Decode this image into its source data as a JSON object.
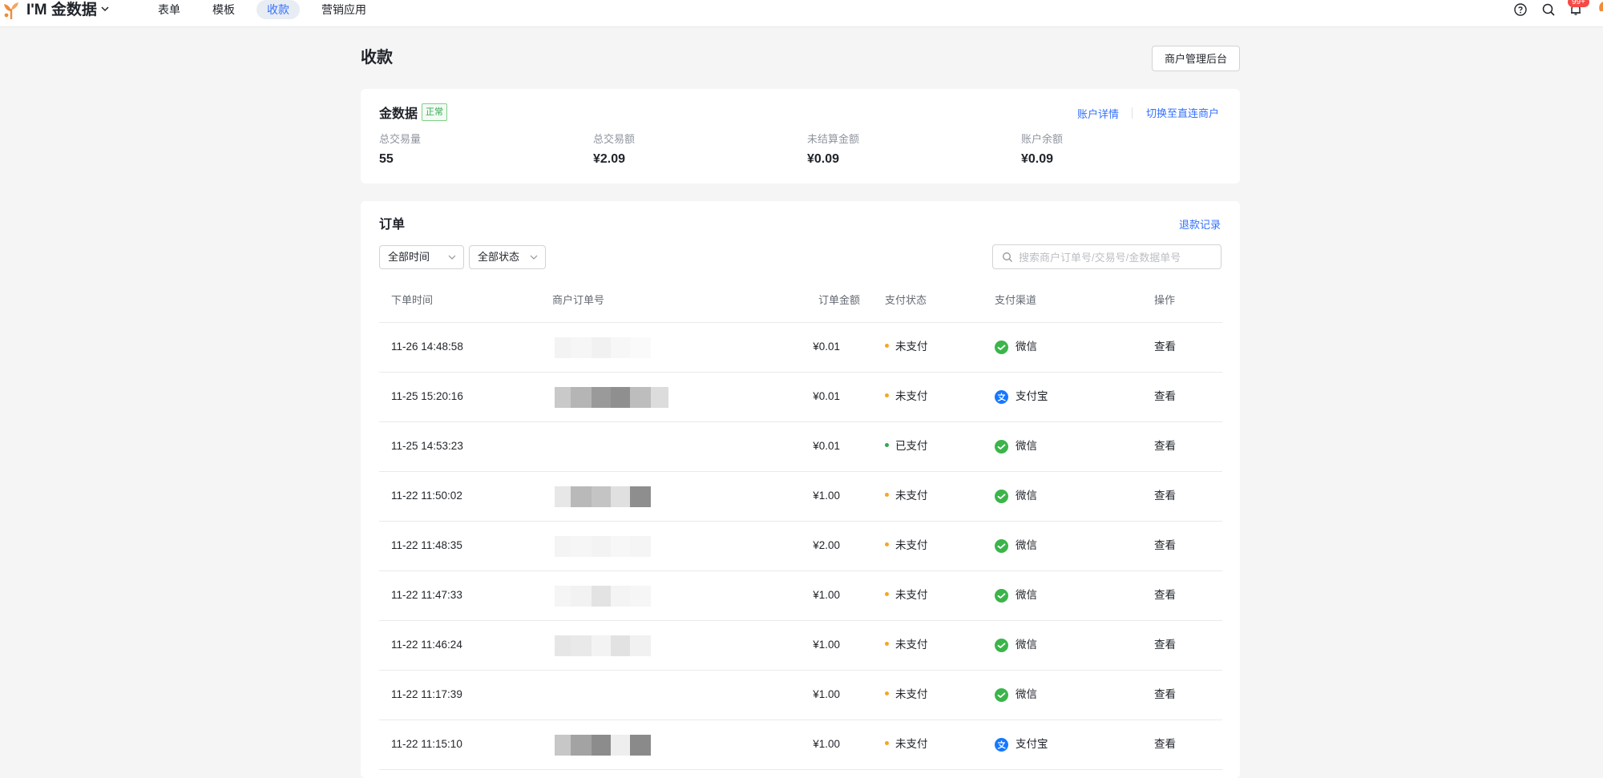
{
  "app": {
    "name": "I'M 金数据",
    "notification_count": "99+"
  },
  "nav": [
    {
      "label": "表单",
      "active": false
    },
    {
      "label": "模板",
      "active": false
    },
    {
      "label": "收款",
      "active": true
    },
    {
      "label": "营销应用",
      "active": false
    }
  ],
  "page": {
    "title": "收款",
    "merchant_button": "商户管理后台"
  },
  "account": {
    "name": "金数据",
    "status": "正常",
    "detail_link": "账户详情",
    "switch_link": "切换至直连商户",
    "stats": [
      {
        "label": "总交易量",
        "value": "55"
      },
      {
        "label": "总交易额",
        "value": "¥2.09"
      },
      {
        "label": "未结算金额",
        "value": "¥0.09"
      },
      {
        "label": "账户余额",
        "value": "¥0.09"
      }
    ]
  },
  "orders": {
    "title": "订单",
    "refund_link": "退款记录",
    "time_filter": "全部时间",
    "status_filter": "全部状态",
    "search_placeholder": "搜索商户订单号/交易号/金数据单号",
    "columns": [
      "下单时间",
      "商户订单号",
      "订单金额",
      "支付状态",
      "支付渠道",
      "操作"
    ],
    "rows": [
      {
        "time": "11-26 14:48:58",
        "amount": "¥0.01",
        "status": "未支付",
        "channel": "微信",
        "action": "查看"
      },
      {
        "time": "11-25 15:20:16",
        "amount": "¥0.01",
        "status": "未支付",
        "channel": "支付宝",
        "action": "查看"
      },
      {
        "time": "11-25 14:53:23",
        "amount": "¥0.01",
        "status": "已支付",
        "channel": "微信",
        "action": "查看"
      },
      {
        "time": "11-22 11:50:02",
        "amount": "¥1.00",
        "status": "未支付",
        "channel": "微信",
        "action": "查看"
      },
      {
        "time": "11-22 11:48:35",
        "amount": "¥2.00",
        "status": "未支付",
        "channel": "微信",
        "action": "查看"
      },
      {
        "time": "11-22 11:47:33",
        "amount": "¥1.00",
        "status": "未支付",
        "channel": "微信",
        "action": "查看"
      },
      {
        "time": "11-22 11:46:24",
        "amount": "¥1.00",
        "status": "未支付",
        "channel": "微信",
        "action": "查看"
      },
      {
        "time": "11-22 11:17:39",
        "amount": "¥1.00",
        "status": "未支付",
        "channel": "微信",
        "action": "查看"
      },
      {
        "time": "11-22 11:15:10",
        "amount": "¥1.00",
        "status": "未支付",
        "channel": "支付宝",
        "action": "查看"
      }
    ]
  },
  "colors": {
    "accent": "#3370ff",
    "unpaid_dot": "#f5a623",
    "paid_dot": "#34a853",
    "wechat": "#3bb54a",
    "alipay": "#1677ff",
    "logo": "#f08c3a"
  }
}
